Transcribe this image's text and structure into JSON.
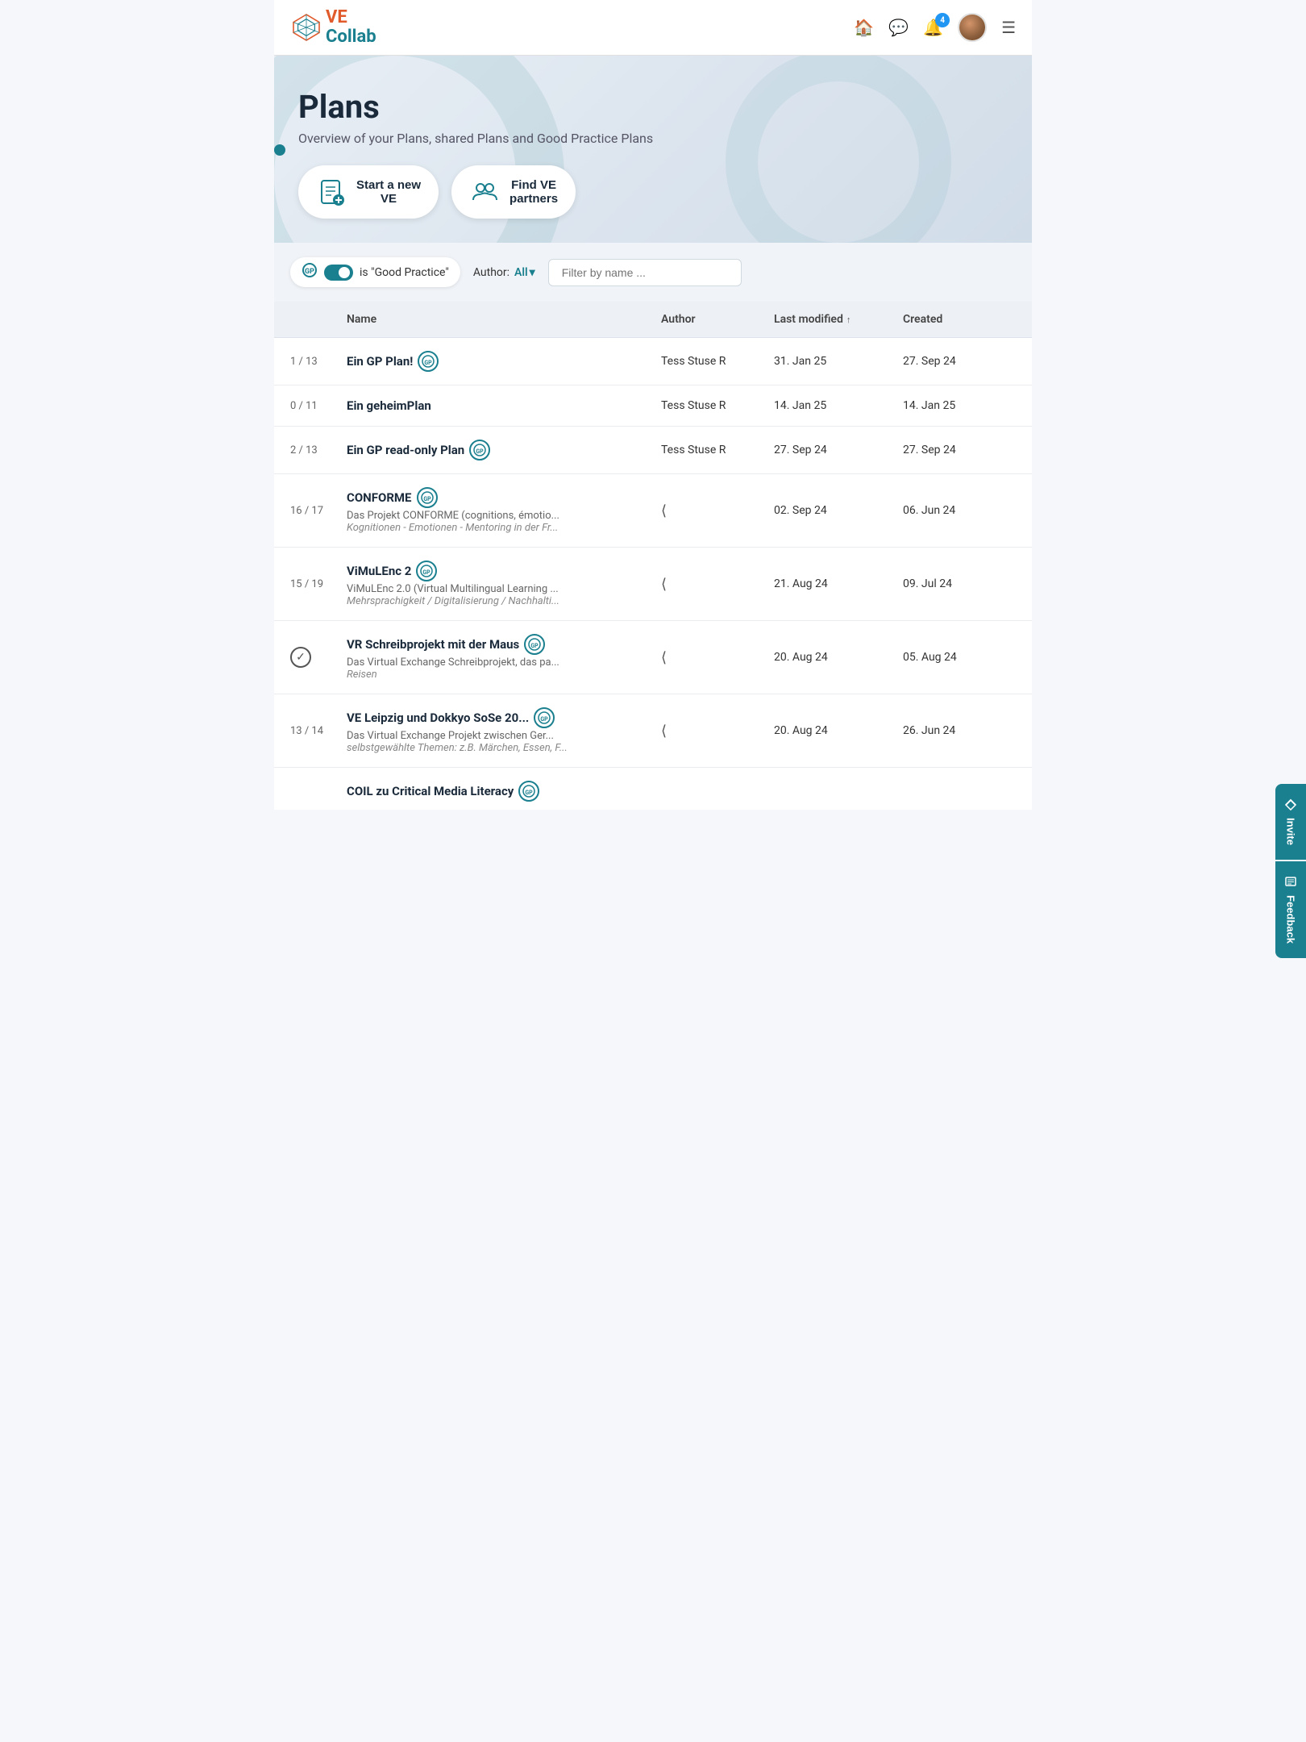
{
  "app": {
    "name": "VECollab",
    "logo_ve": "VE",
    "logo_collab": "Collab"
  },
  "header": {
    "notification_count": "4",
    "icons": {
      "home": "🏠",
      "chat": "💬",
      "bell": "🔔",
      "menu": "☰"
    }
  },
  "page": {
    "title": "Plans",
    "subtitle": "Overview of your Plans, shared Plans and Good Practice Plans"
  },
  "actions": [
    {
      "id": "start-ve",
      "label_line1": "Start a new",
      "label_line2": "VE",
      "icon": "📋"
    },
    {
      "id": "find-partners",
      "label_line1": "Find VE",
      "label_line2": "partners",
      "icon": "👥"
    }
  ],
  "filters": {
    "toggle_label": "is \"Good Practice\"",
    "author_label": "Author:",
    "author_value": "All",
    "filter_placeholder": "Filter by name ..."
  },
  "table": {
    "columns": {
      "name": "Name",
      "author": "Author",
      "last_modified": "Last modified",
      "created": "Created"
    },
    "rows": [
      {
        "count": "1 / 13",
        "name": "Ein GP Plan!",
        "has_gp": true,
        "has_check": false,
        "desc": "",
        "desc_italic": "",
        "author": "Tess Stuse R",
        "last_modified": "31. Jan 25",
        "created": "27. Sep 24",
        "share": false
      },
      {
        "count": "0 / 11",
        "name": "Ein geheimPlan",
        "has_gp": false,
        "has_check": false,
        "desc": "",
        "desc_italic": "",
        "author": "Tess Stuse R",
        "last_modified": "14. Jan 25",
        "created": "14. Jan 25",
        "share": false
      },
      {
        "count": "2 / 13",
        "name": "Ein GP read-only Plan",
        "has_gp": true,
        "has_check": false,
        "desc": "",
        "desc_italic": "",
        "author": "Tess Stuse R",
        "last_modified": "27. Sep 24",
        "created": "27. Sep 24",
        "share": false
      },
      {
        "count": "16 / 17",
        "name": "CONFORME",
        "has_gp": true,
        "has_check": false,
        "desc": "Das Projekt CONFORME (cognitions, émotio...",
        "desc_italic": "Kognitionen - Emotionen - Mentoring in der Fr...",
        "author": "",
        "last_modified": "02. Sep 24",
        "created": "06. Jun 24",
        "share": true
      },
      {
        "count": "15 / 19",
        "name": "ViMuLEnc 2",
        "has_gp": true,
        "has_check": false,
        "desc": "ViMuLEnc 2.0 (Virtual Multilingual Learning ...",
        "desc_italic": "Mehrsprachigkeit / Digitalisierung / Nachhalti...",
        "author": "",
        "last_modified": "21. Aug 24",
        "created": "09. Jul 24",
        "share": true
      },
      {
        "count": "",
        "name": "VR Schreibprojekt mit der Maus",
        "has_gp": true,
        "has_check": true,
        "desc": "Das Virtual Exchange Schreibprojekt, das pa...",
        "desc_italic": "Reisen",
        "author": "",
        "last_modified": "20. Aug 24",
        "created": "05. Aug 24",
        "share": true
      },
      {
        "count": "13 / 14",
        "name": "VE Leipzig und Dokkyo SoSe 20...",
        "has_gp": true,
        "has_check": false,
        "desc": "Das Virtual Exchange Projekt zwischen Ger...",
        "desc_italic": "selbstgewählte Themen: z.B. Märchen, Essen, F...",
        "author": "",
        "last_modified": "20. Aug 24",
        "created": "26. Jun 24",
        "share": true
      },
      {
        "count": "",
        "name": "COIL zu Critical Media Literacy",
        "has_gp": true,
        "has_check": false,
        "desc": "",
        "desc_italic": "",
        "author": "",
        "last_modified": "",
        "created": "",
        "share": false
      }
    ]
  },
  "side_buttons": [
    {
      "id": "invite",
      "label": "Invite",
      "icon": "🔗"
    },
    {
      "id": "feedback",
      "label": "Feedback",
      "icon": "📝"
    }
  ]
}
